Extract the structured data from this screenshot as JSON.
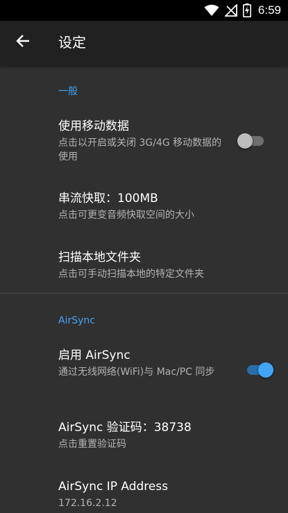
{
  "status_bar": {
    "time": "6:59",
    "icons": [
      "wifi-icon",
      "signal-off-icon",
      "battery-charging-icon"
    ]
  },
  "app_bar": {
    "back_icon": "arrow-left-icon",
    "title": "设定"
  },
  "sections": [
    {
      "header": "一般",
      "items": [
        {
          "title": "使用移动数据",
          "summary": "点击以开启或关闭 3G/4G 移动数据的使用",
          "switch_on": false
        },
        {
          "title": "串流快取：100MB",
          "summary": "点击可更变音频快取空间的大小"
        },
        {
          "title": "扫描本地文件夹",
          "summary": "点击可手动扫描本地的特定文件夹"
        }
      ]
    },
    {
      "header": "AirSync",
      "items": [
        {
          "title": "启用 AirSync",
          "summary": "通过无线网络(WiFi)与 Mac/PC 同步",
          "switch_on": true
        },
        {
          "title": "AirSync 验证码：38738",
          "summary": "点击重置验证码"
        },
        {
          "title": "AirSync IP Address",
          "summary": "172.16.2.12"
        }
      ]
    }
  ],
  "colors": {
    "accent": "#42a5f5",
    "background": "#303030",
    "app_bar": "#212121",
    "status_bar": "#000000"
  }
}
